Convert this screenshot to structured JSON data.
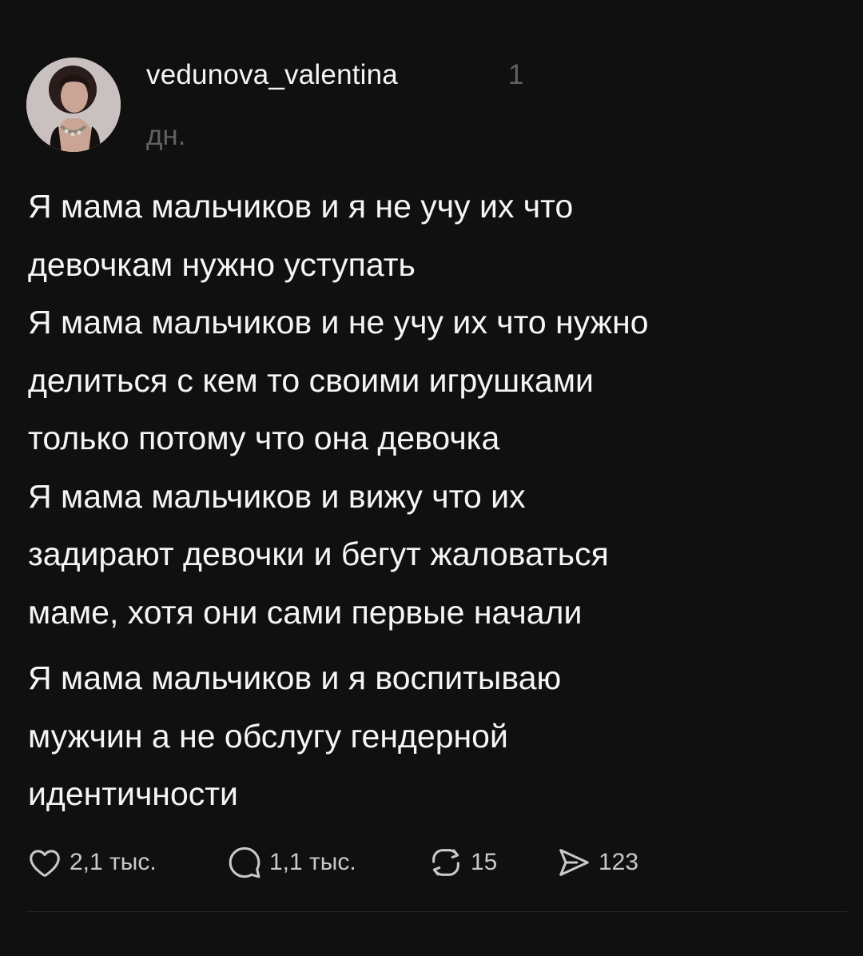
{
  "post": {
    "username": "vedunova_valentina",
    "time_number": "1",
    "time_unit": "дн.",
    "avatar": "user-avatar-photo",
    "paragraphs": [
      {
        "lines": [
          "Я мама мальчиков и я не учу их что",
          "девочкам нужно уступать",
          "Я мама мальчиков и не учу их что нужно",
          "делиться с кем то своими игрушками",
          "только потому что она девочка",
          "Я мама мальчиков и вижу что их",
          "задирают девочки и бегут жаловаться",
          "маме, хотя они сами первые начали"
        ]
      },
      {
        "lines": [
          "Я мама мальчиков и я воспитываю",
          "мужчин а не обслугу гендерной",
          "идентичности"
        ]
      }
    ]
  },
  "actions": {
    "like": {
      "icon": "heart-icon",
      "count": "2,1 тыс."
    },
    "reply": {
      "icon": "comment-icon",
      "count": "1,1 тыс."
    },
    "repost": {
      "icon": "repost-icon",
      "count": "15"
    },
    "share": {
      "icon": "send-icon",
      "count": "123"
    }
  },
  "colors": {
    "background": "#101010",
    "primary_text": "#f3f5f7",
    "secondary_text": "#616161",
    "action_text": "#c9c9c9",
    "divider": "#262626"
  }
}
